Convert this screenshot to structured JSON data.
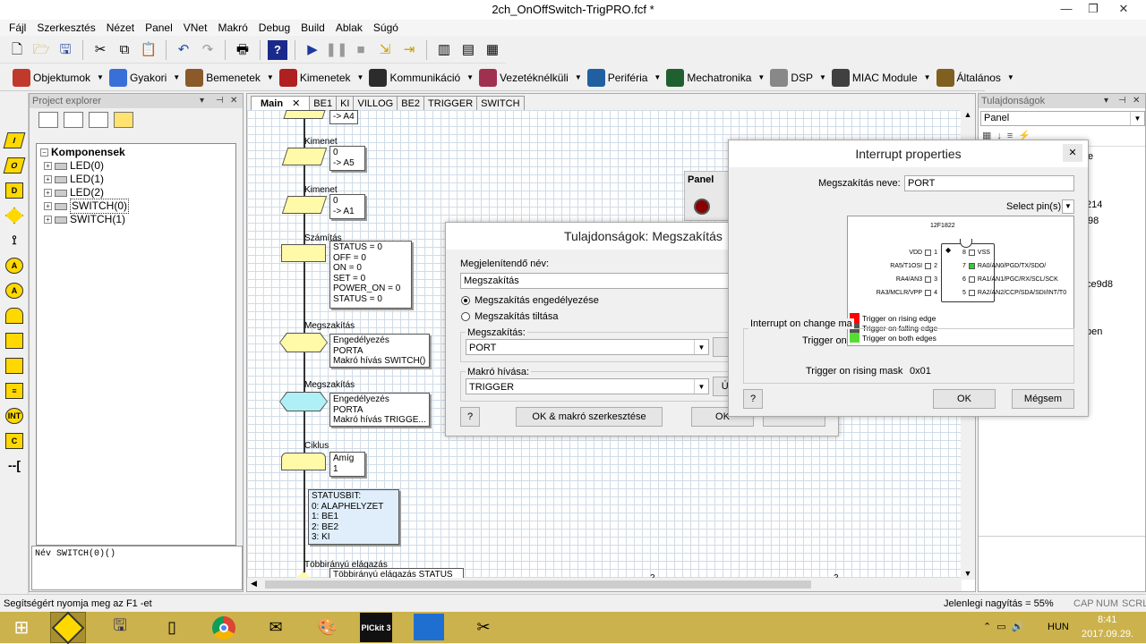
{
  "window": {
    "title": "2ch_OnOffSwitch-TrigPRO.fcf *",
    "min": "—",
    "max": "❐",
    "close": "✕"
  },
  "menu": [
    "Fájl",
    "Szerkesztés",
    "Nézet",
    "Panel",
    "VNet",
    "Makró",
    "Debug",
    "Build",
    "Ablak",
    "Súgó"
  ],
  "categories": [
    {
      "label": "Objektumok",
      "color": "#c0392b"
    },
    {
      "label": "Gyakori",
      "color": "#3a6fd8"
    },
    {
      "label": "Bemenetek",
      "color": "#8a5a2b"
    },
    {
      "label": "Kimenetek",
      "color": "#b02020"
    },
    {
      "label": "Kommunikáció",
      "color": "#2c2c2c"
    },
    {
      "label": "Vezetéknélküli",
      "color": "#a03050"
    },
    {
      "label": "Periféria",
      "color": "#2060a0"
    },
    {
      "label": "Mechatronika",
      "color": "#206030"
    },
    {
      "label": "DSP",
      "color": "#888888"
    },
    {
      "label": "MIAC Module",
      "color": "#404040"
    },
    {
      "label": "Általános",
      "color": "#806020"
    }
  ],
  "project_explorer": {
    "title": "Project explorer",
    "root": "Komponensek",
    "items": [
      "LED(0)",
      "LED(1)",
      "LED(2)",
      "SWITCH(0)",
      "SWITCH(1)"
    ],
    "name_line": "Név SWITCH(0)()"
  },
  "editor": {
    "tabs": [
      "Main",
      "BE1",
      "KI",
      "VILLOG",
      "BE2",
      "TRIGGER",
      "SWITCH"
    ],
    "flow": {
      "top_output_text": "-> A4",
      "kimenet1": {
        "label": "Kimenet",
        "lines": [
          "0",
          "-> A5"
        ]
      },
      "kimenet2": {
        "label": "Kimenet",
        "lines": [
          "0",
          "-> A1"
        ]
      },
      "szamitas": {
        "label": "Számítás",
        "text": "STATUS = 0\nOFF = 0\nON = 0\nSET = 0\nPOWER_ON = 0\nSTATUS = 0"
      },
      "int1": {
        "label": "Megszakítás",
        "text": "Engedélyezés\nPORTA\nMakró hívás SWITCH()"
      },
      "int2": {
        "label": "Megszakítás",
        "text": "Engedélyezés\nPORTA\nMakró hívás TRIGGE..."
      },
      "ciklus": {
        "label": "Ciklus",
        "lines": [
          "Amíg",
          "1"
        ]
      },
      "comment": "STATUSBIT:\n0: ALAPHELYZET\n1: BE1\n2: BE2\n3: KI",
      "switch_label": "Többirányú elágazás",
      "switch_text": "Többirányú elágazás STATUS",
      "num1": "2",
      "num2": "2"
    },
    "panel_label": "Panel"
  },
  "properties_pane": {
    "title": "Tulajdonságok",
    "selector": "Panel",
    "frag1": "e",
    "frag2": "214",
    "frag3": "98",
    "frag4": "ce9d8",
    "frag5": "pen"
  },
  "dialog_megszakitas": {
    "title": "Tulajdonságok: Megszakítás",
    "display_name_label": "Megjelenítendő név:",
    "display_name_value": "Megszakítás",
    "radio_enable": "Megszakítás engedélyezése",
    "radio_disable": "Megszakítás tiltása",
    "interrupt_label": "Megszakítás:",
    "interrupt_value": "PORT",
    "macro_label": "Makró hívása:",
    "macro_value": "TRIGGER",
    "new_btn": "Új",
    "help_btn": "?",
    "ok_edit_btn": "OK & makró szerkesztése",
    "ok_btn": "OK"
  },
  "dialog_interrupt": {
    "title": "Interrupt properties",
    "name_label": "Megszakítás neve:",
    "name_value": "PORT",
    "select_pins": "Select pin(s)",
    "chip": "12F1822",
    "pins_left": [
      {
        "num": "1",
        "label": "VDD"
      },
      {
        "num": "2",
        "label": "RA5/T1OSI"
      },
      {
        "num": "3",
        "label": "RA4/AN3"
      },
      {
        "num": "4",
        "label": "RA3/MCLR/VPP"
      }
    ],
    "pins_right": [
      {
        "num": "8",
        "label": "VSS"
      },
      {
        "num": "7",
        "label": "RA0/AN0/PGD/TX/SDO/"
      },
      {
        "num": "6",
        "label": "RA1/AN1/PGC/RX/SCL/SCK"
      },
      {
        "num": "5",
        "label": "RA2/AN2/CCP/SDA/SDI/INT/T0"
      }
    ],
    "legend": [
      {
        "label": "Trigger on rising edge",
        "color": "#ff0000"
      },
      {
        "label": "Trigger on falling edge",
        "color": "#555555"
      },
      {
        "label": "Trigger on both edges",
        "color": "#55dd33"
      }
    ],
    "change_group_label": "Interrupt on change ma",
    "trigger_on_label": "Trigger on",
    "mask_label": "Trigger on rising mask",
    "mask_value": "0x01",
    "help_btn": "?",
    "ok_btn": "OK",
    "cancel_btn": "Mégsem"
  },
  "statusbar": {
    "help": "Segítségért nyomja meg az F1 -et",
    "zoom": "Jelenlegi nagyítás = 55%",
    "caps": "CAP",
    "num": "NUM",
    "scrl": "SCRL"
  },
  "taskbar": {
    "lang": "HUN",
    "time": "8:41",
    "date": "2017.09.29.",
    "pickit": "PICkit 3"
  }
}
